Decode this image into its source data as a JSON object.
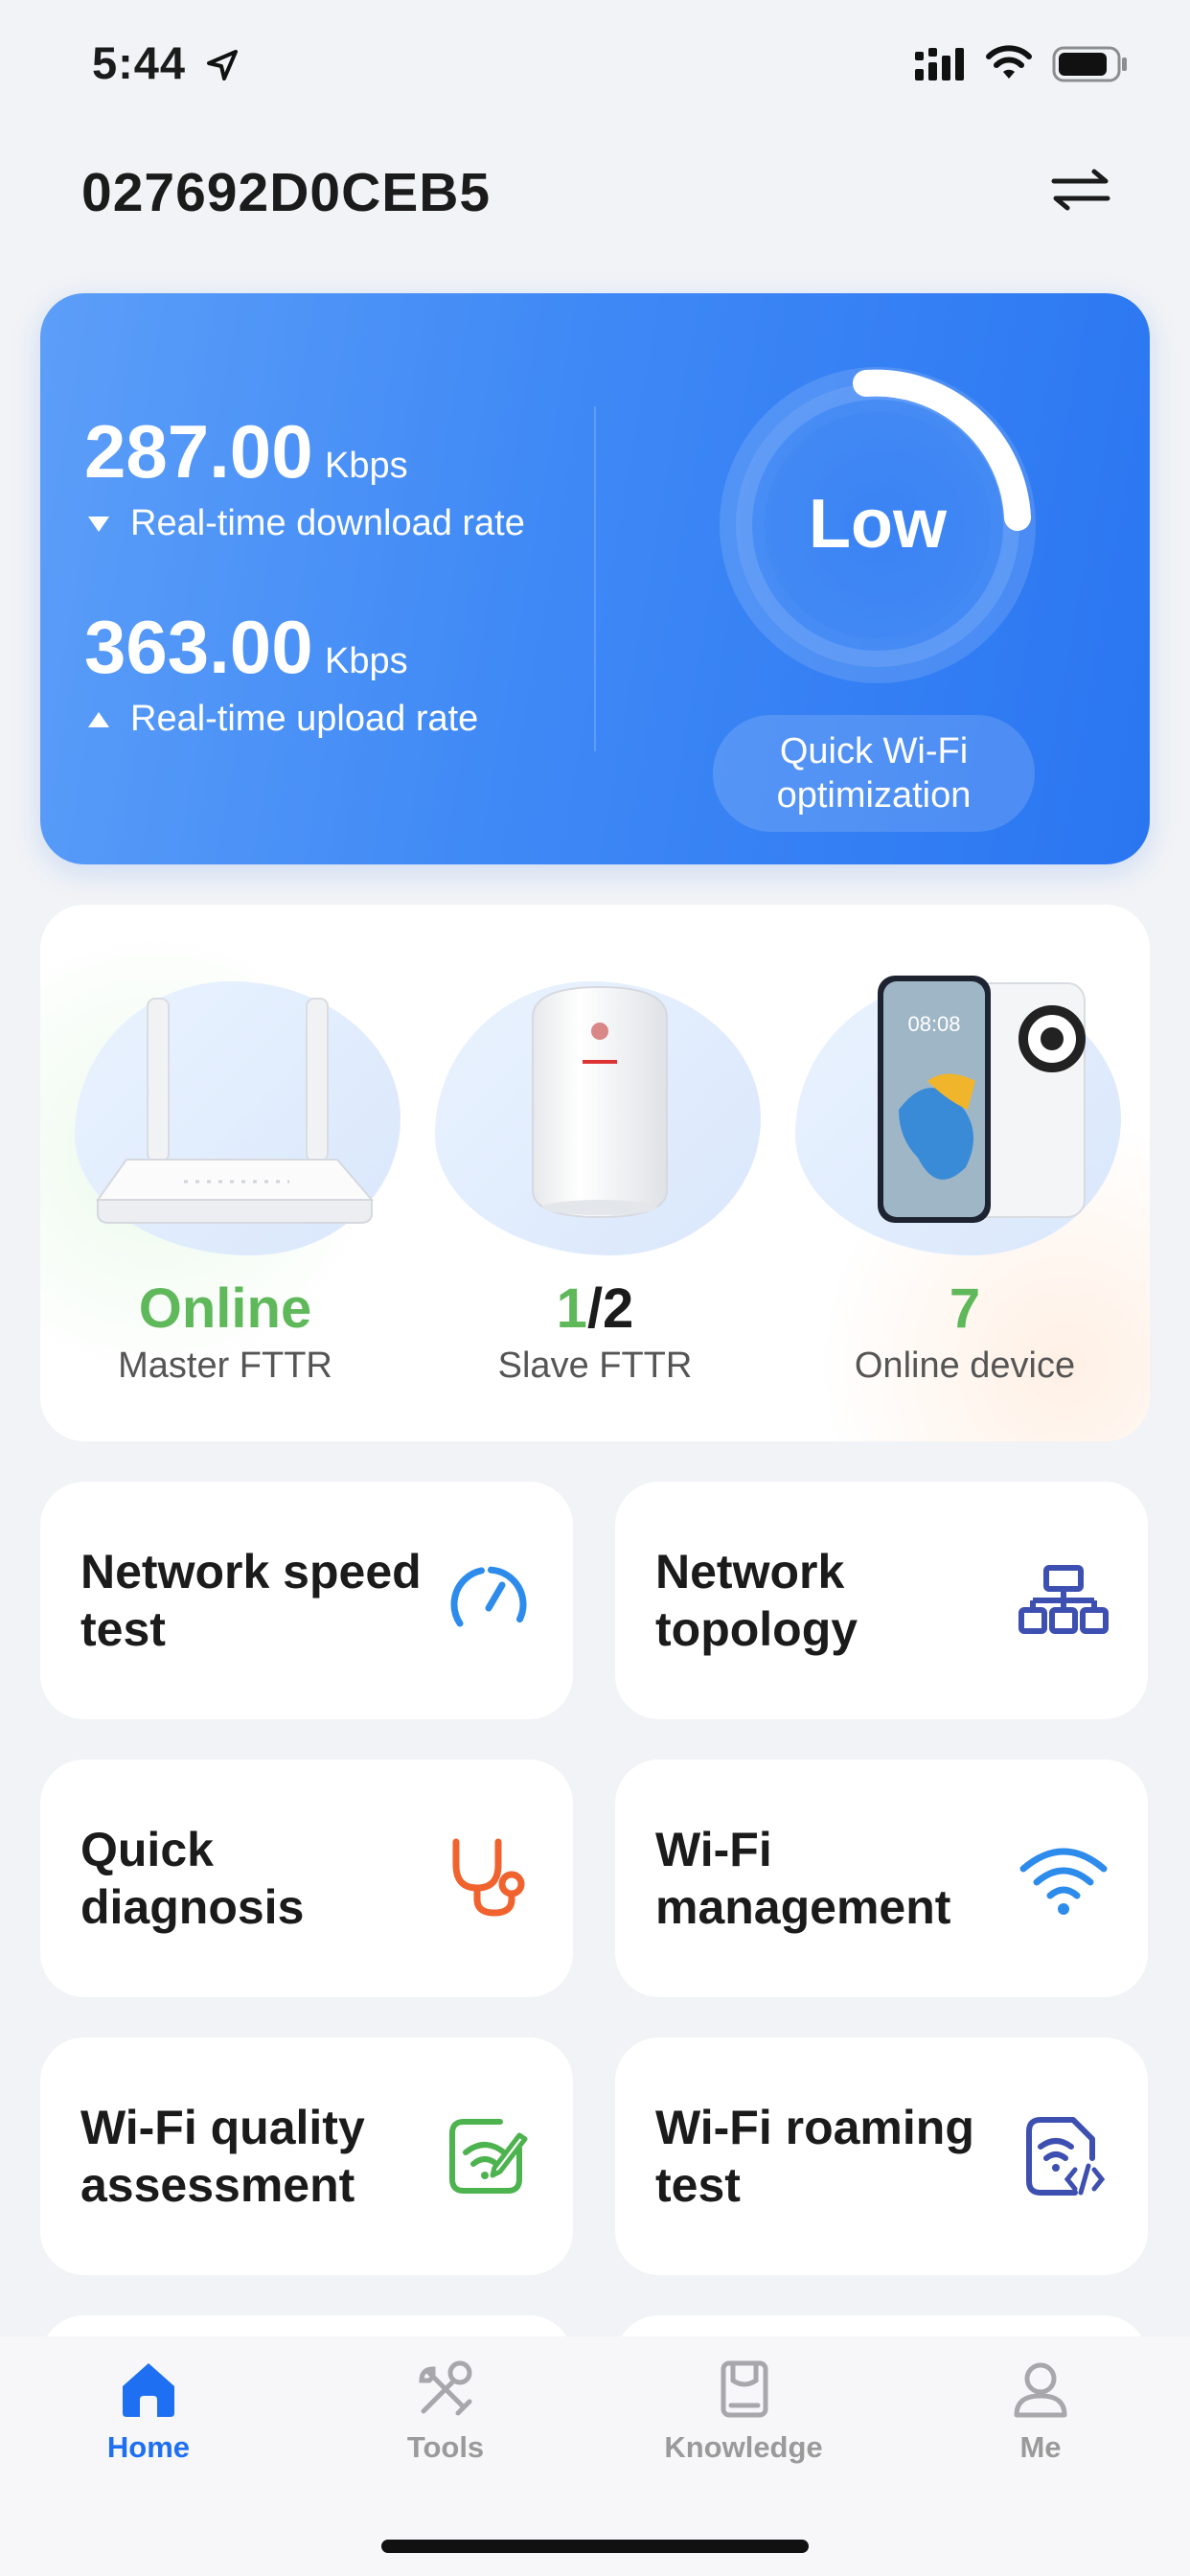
{
  "status_bar": {
    "time": "5:44"
  },
  "header": {
    "title": "027692D0CEB5"
  },
  "rate_card": {
    "download_value": "287.00",
    "download_unit": "Kbps",
    "download_label": "Real-time download rate",
    "upload_value": "363.00",
    "upload_unit": "Kbps",
    "upload_label": "Real-time upload rate",
    "gauge_text": "Low",
    "optimize_button": "Quick Wi-Fi optimization"
  },
  "devices": {
    "master": {
      "value": "Online",
      "label": "Master FTTR"
    },
    "slave": {
      "value_online": "1",
      "value_total": "/2",
      "label": "Slave FTTR"
    },
    "online": {
      "value": "7",
      "label": "Online device"
    },
    "phone_clock": "08:08"
  },
  "tiles": [
    {
      "label": "Network speed test",
      "icon": "speedometer-icon",
      "color": "#2D8CEB"
    },
    {
      "label": "Network topology",
      "icon": "topology-icon",
      "color": "#3D4FB0"
    },
    {
      "label": "Quick diagnosis",
      "icon": "stethoscope-icon",
      "color": "#F0632E"
    },
    {
      "label": "Wi-Fi management",
      "icon": "wifi-icon",
      "color": "#2D8CEB"
    },
    {
      "label": "Wi-Fi quality assessment",
      "icon": "wifi-edit-icon",
      "color": "#4CB34E"
    },
    {
      "label": "Wi-Fi roaming test",
      "icon": "wifi-code-icon",
      "color": "#3D4FB0"
    }
  ],
  "nav": [
    {
      "label": "Home",
      "icon": "home-icon",
      "active": true
    },
    {
      "label": "Tools",
      "icon": "tools-icon",
      "active": false
    },
    {
      "label": "Knowledge",
      "icon": "book-icon",
      "active": false
    },
    {
      "label": "Me",
      "icon": "user-icon",
      "active": false
    }
  ],
  "colors": {
    "accent": "#1E6FF1",
    "online_green": "#5FB85A"
  }
}
